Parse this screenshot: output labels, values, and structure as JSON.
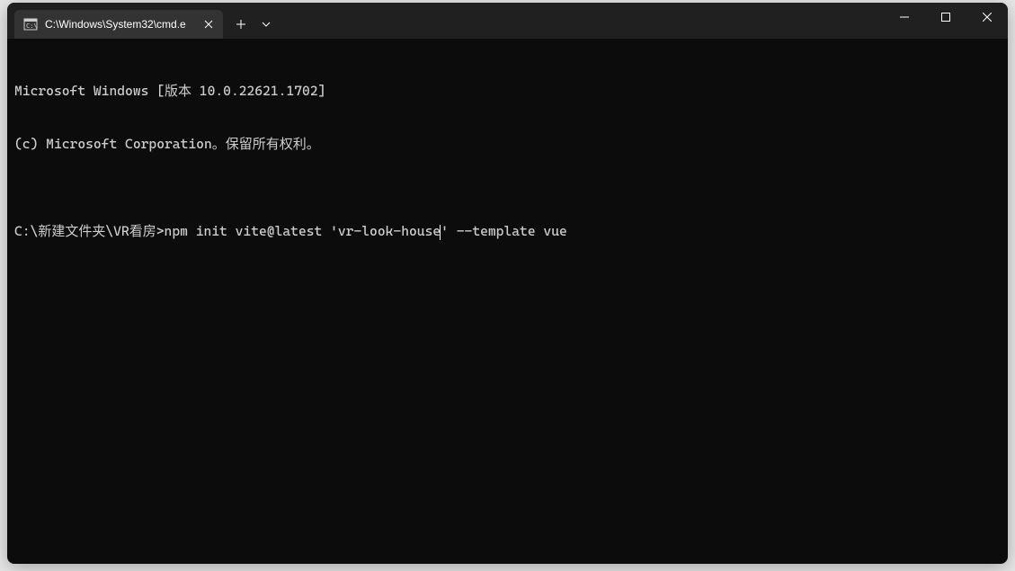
{
  "window": {
    "tab_title": "C:\\Windows\\System32\\cmd.e"
  },
  "terminal": {
    "line1": "Microsoft Windows [版本 10.0.22621.1702]",
    "line2": "(c) Microsoft Corporation。保留所有权利。",
    "blank": "",
    "prompt": "C:\\新建文件夹\\VR看房>",
    "command_part1": "npm init vite@latest 'vr-look-house",
    "command_part2": "' --template vue"
  }
}
